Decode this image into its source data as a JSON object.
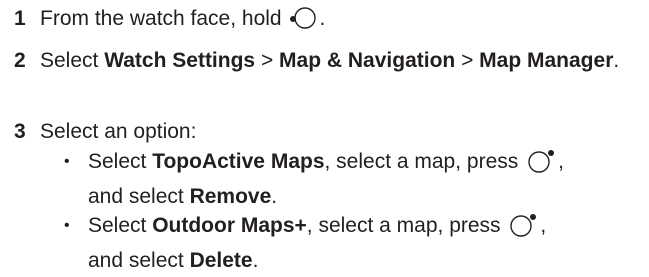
{
  "steps": [
    {
      "number": "1",
      "text_before_icon": "From the watch face, hold ",
      "text_after_icon": ".",
      "icon": "watch-button-left-icon"
    },
    {
      "number": "2",
      "select": "Select ",
      "watch_settings": "Watch Settings",
      "sep1": " > ",
      "map_navigation": "Map & Navigation",
      "sep2": " > ",
      "map_manager": "Map Manager",
      "end": "."
    },
    {
      "number": "3",
      "text": "Select an option:"
    }
  ],
  "bullets": [
    {
      "marker": "•",
      "select": "Select ",
      "item": "TopoActive Maps",
      "middle": ", select a map, press ",
      "icon": "watch-button-right-icon",
      "comma": ",",
      "line2_before": "and select ",
      "action": "Remove",
      "end": "."
    },
    {
      "marker": "•",
      "select": "Select ",
      "item": "Outdoor Maps+",
      "middle": ", select a map, press ",
      "icon": "watch-button-right-icon",
      "comma": ",",
      "line2_before": "and select ",
      "action": "Delete",
      "end": "."
    }
  ]
}
